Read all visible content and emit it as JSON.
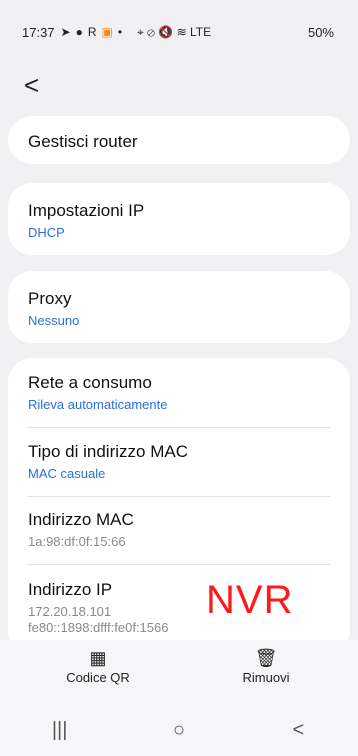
{
  "status": {
    "time": "17:37",
    "icons": [
      "navigation-icon",
      "whatsapp-icon",
      "r-icon",
      "app-icon",
      "dot"
    ],
    "right_icons": "⌖ ⊘ 🔇 ≋ LTE",
    "battery": "50%"
  },
  "back_glyph": "<",
  "manage_router": "Gestisci router",
  "ip_settings": {
    "title": "Impostazioni IP",
    "value": "DHCP"
  },
  "proxy": {
    "title": "Proxy",
    "value": "Nessuno"
  },
  "metered": {
    "title": "Rete a consumo",
    "value": "Rileva automaticamente"
  },
  "mac_type": {
    "title": "Tipo di indirizzo MAC",
    "value": "MAC casuale"
  },
  "mac_address": {
    "title": "Indirizzo MAC",
    "value": "1a:98:df:0f:15:66"
  },
  "ip_address": {
    "title": "Indirizzo IP",
    "ipv4": "172.20.18.101",
    "ipv6": "fe80::1898:dfff:fe0f:1566"
  },
  "overlay_text": "NVR",
  "bottom": {
    "qr_label": "Codice QR",
    "remove_label": "Rimuovi"
  },
  "nav": {
    "recent": "|||",
    "home": "○",
    "back": "<"
  },
  "colors": {
    "accent": "#2b6fd6",
    "overlay": "#ff1a1a"
  }
}
